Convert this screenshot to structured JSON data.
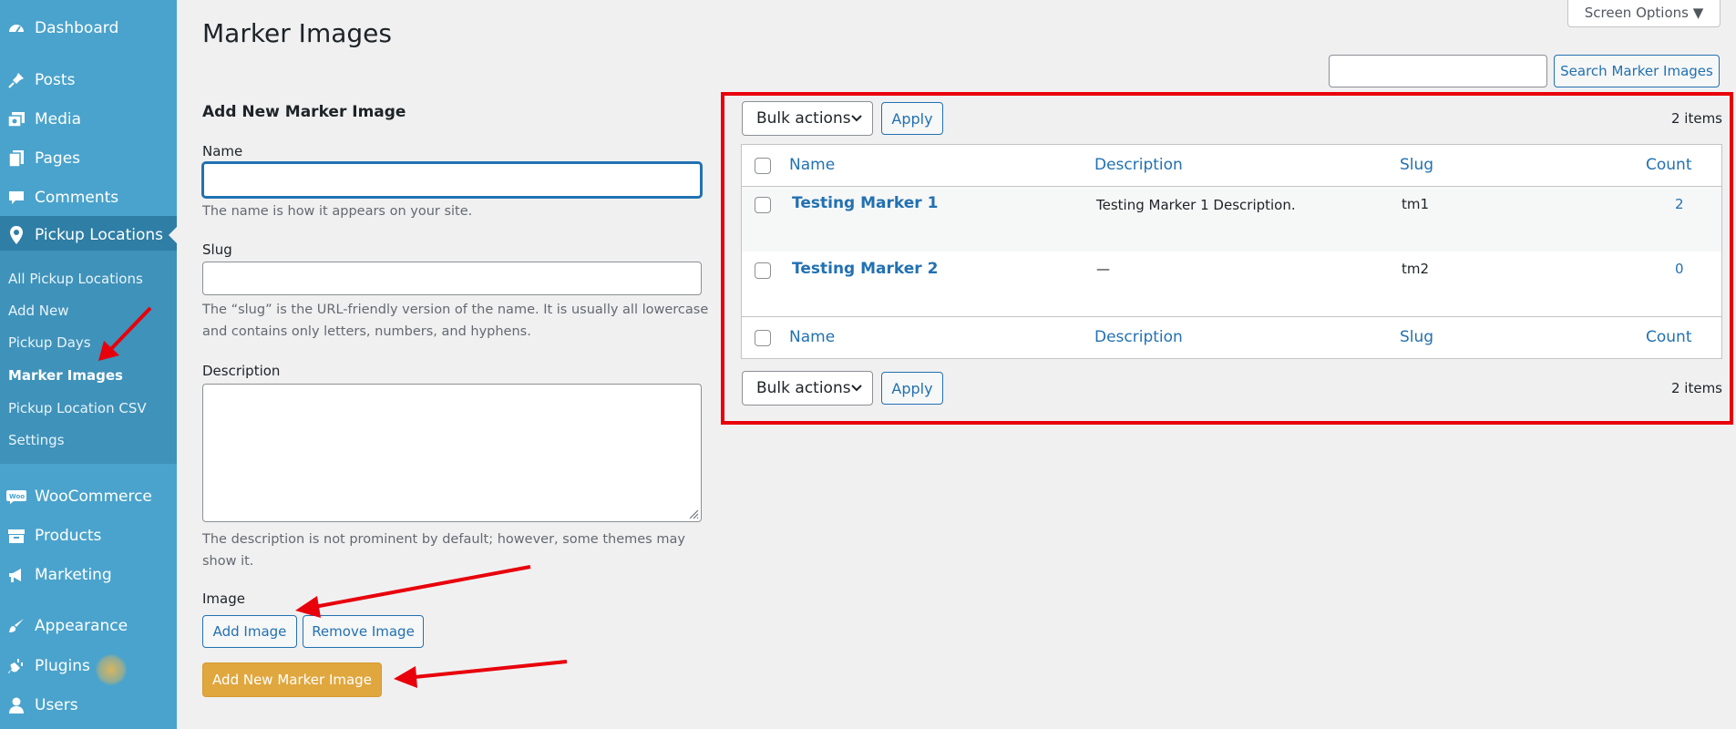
{
  "sidebar": {
    "items": [
      {
        "label": "Dashboard",
        "icon": "dashboard-icon"
      },
      {
        "label": "Posts",
        "icon": "pin-icon"
      },
      {
        "label": "Media",
        "icon": "media-icon"
      },
      {
        "label": "Pages",
        "icon": "pages-icon"
      },
      {
        "label": "Comments",
        "icon": "comment-icon"
      },
      {
        "label": "Pickup Locations",
        "icon": "location-icon"
      },
      {
        "label": "WooCommerce",
        "icon": "woo-icon"
      },
      {
        "label": "Products",
        "icon": "archive-icon"
      },
      {
        "label": "Marketing",
        "icon": "megaphone-icon"
      },
      {
        "label": "Appearance",
        "icon": "brush-icon"
      },
      {
        "label": "Plugins",
        "icon": "plugin-icon"
      },
      {
        "label": "Users",
        "icon": "user-icon"
      }
    ],
    "submenu": [
      "All Pickup Locations",
      "Add New",
      "Pickup Days",
      "Marker Images",
      "Pickup Location CSV",
      "Settings"
    ]
  },
  "header": {
    "title": "Marker Images",
    "screen_options": "Screen Options ▼",
    "search_value": "",
    "search_button": "Search Marker Images"
  },
  "form": {
    "heading": "Add New Marker Image",
    "name_label": "Name",
    "name_value": "",
    "name_help": "The name is how it appears on your site.",
    "slug_label": "Slug",
    "slug_value": "",
    "slug_help_1": "The “slug” is the URL-friendly version of the name. It is usually all lowercase",
    "slug_help_2": "and contains only letters, numbers, and hyphens.",
    "description_label": "Description",
    "description_value": "",
    "description_help_1": "The description is not prominent by default; however, some themes may",
    "description_help_2": "show it.",
    "image_label": "Image",
    "add_image": "Add Image",
    "remove_image": "Remove Image",
    "submit": "Add New Marker Image"
  },
  "table": {
    "bulk_actions": "Bulk actions",
    "apply": "Apply",
    "items_count": "2 items",
    "columns": {
      "name": "Name",
      "description": "Description",
      "slug": "Slug",
      "count": "Count"
    },
    "rows": [
      {
        "name": "Testing Marker 1",
        "description": "Testing Marker 1 Description.",
        "slug": "tm1",
        "count": "2"
      },
      {
        "name": "Testing Marker 2",
        "description": "—",
        "slug": "tm2",
        "count": "0"
      }
    ]
  },
  "colors": {
    "sidebar": "#4aa3cc",
    "sidebar_active": "#2e7ea6",
    "link": "#2271b1",
    "primary_button": "#e0a73f",
    "annotation_red": "#e8000b"
  }
}
